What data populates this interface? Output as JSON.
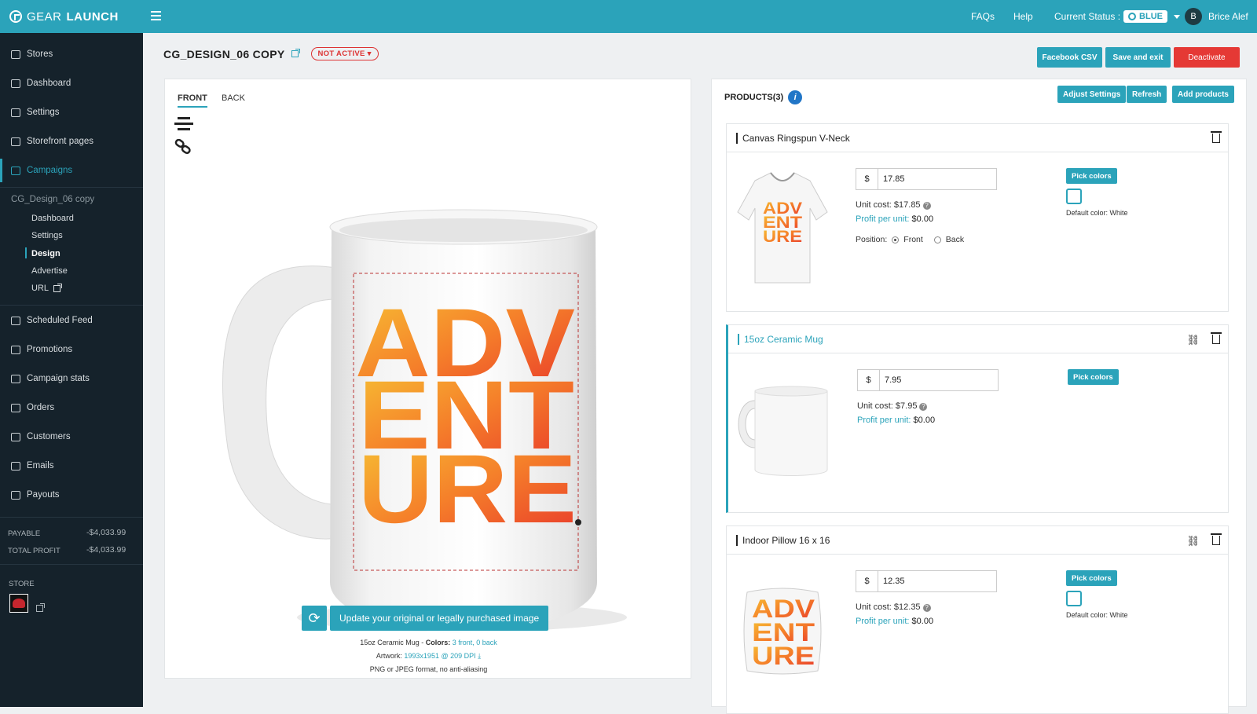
{
  "brand": {
    "name_light": "GEAR",
    "name_bold": "LAUNCH"
  },
  "topnav": {
    "faqs": "FAQs",
    "help": "Help",
    "status_label": "Current Status :",
    "status_value": "BLUE",
    "user_initial": "B",
    "user_name": "Brice Alef"
  },
  "sidebar": {
    "items": [
      {
        "label": "Stores",
        "icon": "home-icon"
      },
      {
        "label": "Dashboard",
        "icon": "dashboard-icon"
      },
      {
        "label": "Settings",
        "icon": "gear-icon"
      },
      {
        "label": "Storefront pages",
        "icon": "storefront-icon"
      },
      {
        "label": "Campaigns",
        "icon": "campaigns-icon"
      }
    ],
    "campaign_name": "CG_Design_06 copy",
    "sub_items": [
      "Dashboard",
      "Settings",
      "Design",
      "Advertise",
      "URL"
    ],
    "items2": [
      {
        "label": "Scheduled Feed",
        "icon": "rss-icon"
      },
      {
        "label": "Promotions",
        "icon": "tag-icon"
      },
      {
        "label": "Campaign stats",
        "icon": "stats-icon"
      },
      {
        "label": "Orders",
        "icon": "orders-icon"
      },
      {
        "label": "Customers",
        "icon": "customers-icon"
      },
      {
        "label": "Emails",
        "icon": "email-icon"
      },
      {
        "label": "Payouts",
        "icon": "payouts-icon"
      }
    ],
    "payable_label": "PAYABLE",
    "payable_value": "-$4,033.99",
    "profit_label": "TOTAL PROFIT",
    "profit_value": "-$4,033.99",
    "store_label": "STORE"
  },
  "header": {
    "title": "CG_DESIGN_06 COPY",
    "status_badge": "NOT ACTIVE",
    "facebook_csv": "Facebook CSV",
    "save_exit": "Save and exit",
    "deactivate": "Deactivate"
  },
  "design": {
    "tab_front": "FRONT",
    "tab_back": "BACK",
    "artwork_lines": [
      "ADV",
      "ENT",
      "URE"
    ],
    "update_button": "Update your original or legally purchased image",
    "info_product": "15oz Ceramic Mug - ",
    "info_colors_label": "Colors: ",
    "info_colors_value": "3 front, 0 back",
    "info_artwork_label": "Artwork: ",
    "info_artwork_value": "1993x1951 @ 209 DPI",
    "info_format": "PNG or JPEG format, no anti-aliasing"
  },
  "products": {
    "title": "PRODUCTS(3)",
    "adjust": "Adjust Settings",
    "refresh": "Refresh",
    "add": "Add products",
    "list": [
      {
        "name": "Canvas Ringspun V-Neck",
        "price": "17.85",
        "unit_cost": "Unit cost: $17.85",
        "profit_label": "Profit per unit:",
        "profit_value": "$0.00",
        "pick": "Pick colors",
        "default_color": "Default color: White",
        "position_label": "Position:",
        "front": "Front",
        "back": "Back"
      },
      {
        "name": "15oz Ceramic Mug",
        "price": "7.95",
        "unit_cost": "Unit cost: $7.95",
        "profit_label": "Profit per unit:",
        "profit_value": "$0.00",
        "pick": "Pick colors"
      },
      {
        "name": "Indoor Pillow 16 x 16",
        "price": "12.35",
        "unit_cost": "Unit cost: $12.35",
        "profit_label": "Profit per unit:",
        "profit_value": "$0.00",
        "pick": "Pick colors",
        "default_color": "Default color: White"
      }
    ],
    "currency": "$"
  },
  "colors": {
    "accent": "#2ba3ba",
    "sidebar": "#15222b",
    "danger": "#e53935",
    "info": "#2176c7"
  }
}
